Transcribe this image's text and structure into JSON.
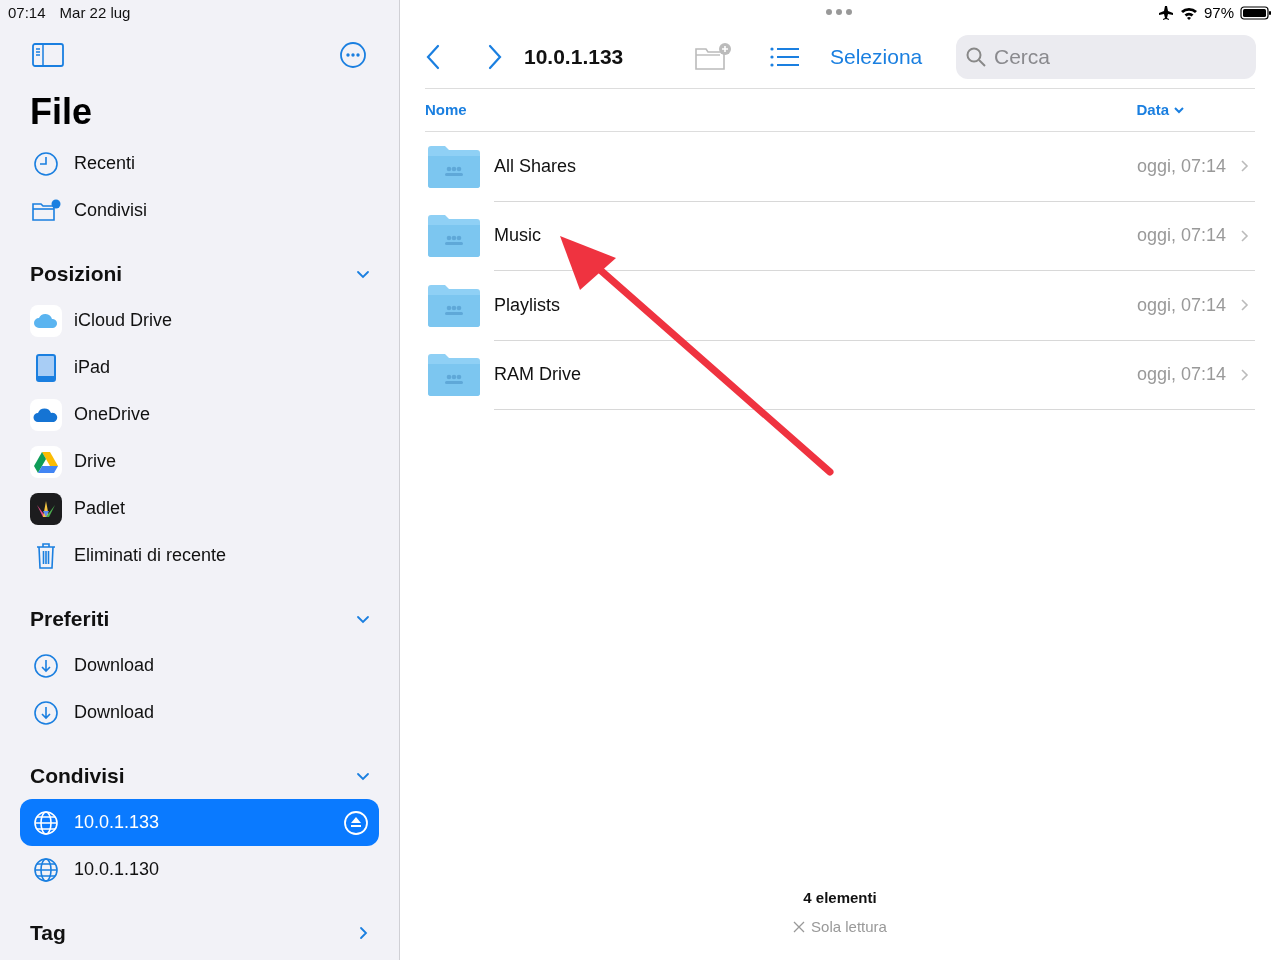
{
  "status_bar": {
    "time": "07:14",
    "date": "Mar 22 lug",
    "battery": "97%"
  },
  "sidebar": {
    "title": "File",
    "top_items": [
      {
        "label": "Recenti",
        "kind": "clock"
      },
      {
        "label": "Condivisi",
        "kind": "shared-folder"
      }
    ],
    "sections": [
      {
        "heading": "Posizioni",
        "expanded": true,
        "items": [
          {
            "label": "iCloud Drive",
            "kind": "icloud",
            "selected": false
          },
          {
            "label": "iPad",
            "kind": "ipad",
            "selected": false
          },
          {
            "label": "OneDrive",
            "kind": "onedrive",
            "selected": false
          },
          {
            "label": "Drive",
            "kind": "drive",
            "selected": false
          },
          {
            "label": "Padlet",
            "kind": "padlet",
            "selected": false
          },
          {
            "label": "Eliminati di recente",
            "kind": "trash",
            "selected": false
          }
        ]
      },
      {
        "heading": "Preferiti",
        "expanded": true,
        "items": [
          {
            "label": "Download",
            "kind": "download",
            "selected": false
          },
          {
            "label": "Download",
            "kind": "download",
            "selected": false
          }
        ]
      },
      {
        "heading": "Condivisi",
        "expanded": true,
        "items": [
          {
            "label": "10.0.1.133",
            "kind": "server",
            "selected": true
          },
          {
            "label": "10.0.1.130",
            "kind": "server",
            "selected": false
          }
        ]
      },
      {
        "heading": "Tag",
        "expanded": false
      }
    ]
  },
  "toolbar": {
    "title": "10.0.1.133",
    "select": "Seleziona",
    "search": {
      "placeholder": "Cerca"
    }
  },
  "table": {
    "columns": [
      {
        "label": "Nome",
        "sorted": false
      },
      {
        "label": "Data",
        "sorted": true
      }
    ],
    "rows": [
      {
        "name": "All Shares",
        "date": "oggi, 07:14"
      },
      {
        "name": "Music",
        "date": "oggi, 07:14"
      },
      {
        "name": "Playlists",
        "date": "oggi, 07:14"
      },
      {
        "name": "RAM Drive",
        "date": "oggi, 07:14"
      }
    ]
  },
  "footer": {
    "count": "4 elementi",
    "status": "Sola lettura"
  }
}
